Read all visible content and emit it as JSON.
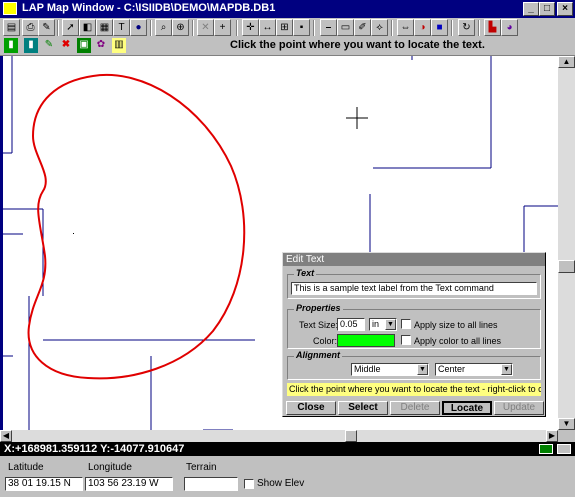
{
  "window": {
    "title": "LAP Map Window - C:\\ISIIDB\\DEMO\\MAPDB.DB1",
    "minimize": "_",
    "maximize": "□",
    "close": "×"
  },
  "toolbar": {
    "message": "Click the point where you want to locate the text."
  },
  "coords": {
    "text": "X:+168981.359112 Y:-14077.910647"
  },
  "bottom": {
    "latitude_label": "Latitude",
    "latitude_value": "38 01 19.15 N",
    "longitude_label": "Longitude",
    "longitude_value": "103 56 23.19 W",
    "terrain_label": "Terrain",
    "terrain_value": "",
    "show_elev_label": "Show Elev"
  },
  "dialog": {
    "title": "Edit Text",
    "text_group": "Text",
    "text_value": "This is a sample text label from the Text command",
    "properties_group": "Properties",
    "text_size_label": "Text Size:",
    "text_size_value": "0.05",
    "text_unit": "in",
    "apply_size_label": "Apply size to all lines",
    "color_label": "Color:",
    "color_value": "#00ff00",
    "apply_color_label": "Apply color to all lines",
    "alignment_group": "Alignment",
    "vertical_align": "Middle",
    "horizontal_align": "Center",
    "hint": "Click the point where you want to locate the text - right-click to cancel",
    "buttons": {
      "close": "Close",
      "select": "Select",
      "delete": "Delete",
      "locate": "Locate",
      "update": "Update"
    }
  },
  "colors": {
    "map_lines": "#000080",
    "boundary": "#e00000",
    "titlebar": "#000080"
  },
  "icons": [
    "save-icon",
    "print-icon",
    "edit-icon",
    "arrow-select-icon",
    "layers-icon",
    "table-icon",
    "text-icon",
    "info-icon",
    "zoom-window-icon",
    "zoom-icon",
    "delete-icon",
    "add-icon",
    "crosshair-icon",
    "measure-icon",
    "grid-icon",
    "ruler-icon",
    "palette-icon",
    "refresh-icon",
    "chart-icon",
    "globe-icon"
  ]
}
